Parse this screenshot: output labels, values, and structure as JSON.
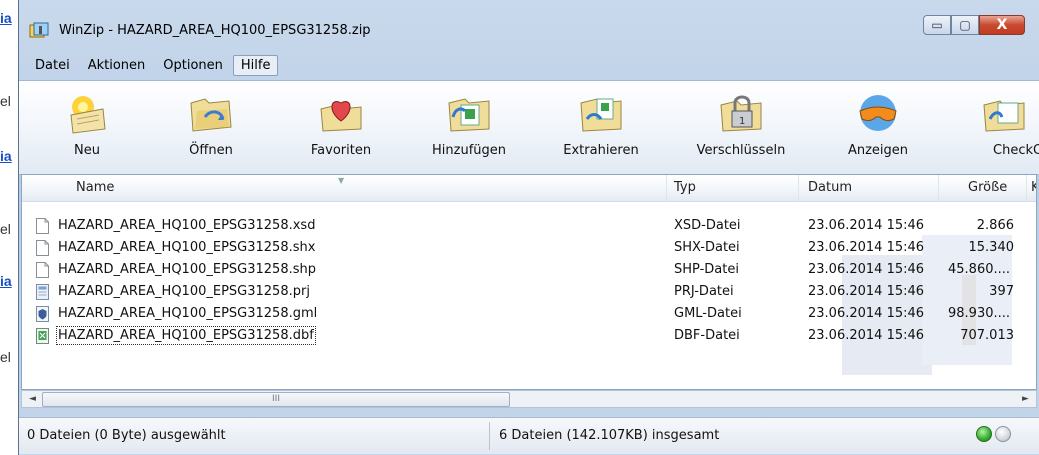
{
  "background_page": {
    "fragments": [
      {
        "text": "ia",
        "kind": "link"
      },
      {
        "text": "el",
        "kind": "text"
      },
      {
        "text": "ia",
        "kind": "link"
      },
      {
        "text": "el",
        "kind": "text"
      },
      {
        "text": "ia",
        "kind": "link"
      },
      {
        "text": "el",
        "kind": "text"
      }
    ]
  },
  "window": {
    "title": "WinZip - HAZARD_AREA_HQ100_EPSG31258.zip",
    "buttons": {
      "minimize": "▭",
      "maximize": "▢",
      "close": "X"
    }
  },
  "menu": {
    "items": [
      {
        "label": "Datei"
      },
      {
        "label": "Aktionen"
      },
      {
        "label": "Optionen"
      },
      {
        "label": "Hilfe",
        "active": true
      }
    ]
  },
  "toolbar": {
    "tools": [
      {
        "label": "Neu",
        "icon": "new-archive-icon"
      },
      {
        "label": "Öffnen",
        "icon": "open-folder-icon"
      },
      {
        "label": "Favoriten",
        "icon": "favorites-heart-icon"
      },
      {
        "label": "Hinzufügen",
        "icon": "add-files-icon"
      },
      {
        "label": "Extrahieren",
        "icon": "extract-icon"
      },
      {
        "label": "Verschlüsseln",
        "icon": "encrypt-lock-icon"
      },
      {
        "label": "Anzeigen",
        "icon": "view-glasses-icon"
      },
      {
        "label": "CheckOu",
        "icon": "checkout-icon"
      }
    ]
  },
  "file_list": {
    "columns": [
      "Name",
      "Typ",
      "Datum",
      "Größe",
      "K"
    ],
    "rows": [
      {
        "name": "HAZARD_AREA_HQ100_EPSG31258.xsd",
        "type": "XSD-Datei",
        "date": "23.06.2014 15:46",
        "size": "2.866",
        "icon": "document-icon"
      },
      {
        "name": "HAZARD_AREA_HQ100_EPSG31258.shx",
        "type": "SHX-Datei",
        "date": "23.06.2014 15:46",
        "size": "15.340",
        "icon": "document-icon"
      },
      {
        "name": "HAZARD_AREA_HQ100_EPSG31258.shp",
        "type": "SHP-Datei",
        "date": "23.06.2014 15:46",
        "size": "45.860....",
        "icon": "document-icon"
      },
      {
        "name": "HAZARD_AREA_HQ100_EPSG31258.prj",
        "type": "PRJ-Datei",
        "date": "23.06.2014 15:46",
        "size": "397",
        "icon": "text-document-icon"
      },
      {
        "name": "HAZARD_AREA_HQ100_EPSG31258.gml",
        "type": "GML-Datei",
        "date": "23.06.2014 15:46",
        "size": "98.930....",
        "icon": "shield-document-icon"
      },
      {
        "name": "HAZARD_AREA_HQ100_EPSG31258.dbf",
        "type": "DBF-Datei",
        "date": "23.06.2014 15:46",
        "size": "707.013",
        "icon": "spreadsheet-document-icon",
        "focused": true
      }
    ]
  },
  "scrollbar": {
    "thumb_grip": "III",
    "left_arrow": "◄",
    "right_arrow": "►"
  },
  "status": {
    "selected": "0 Dateien (0 Byte) ausgewählt",
    "total": "6 Dateien (142.107KB) insgesamt",
    "lights": [
      {
        "state": "green"
      },
      {
        "state": "grey"
      }
    ]
  },
  "colors": {
    "accent": "#1a4fc4",
    "close_button": "#c94a32",
    "status_green": "#2fae2a"
  }
}
